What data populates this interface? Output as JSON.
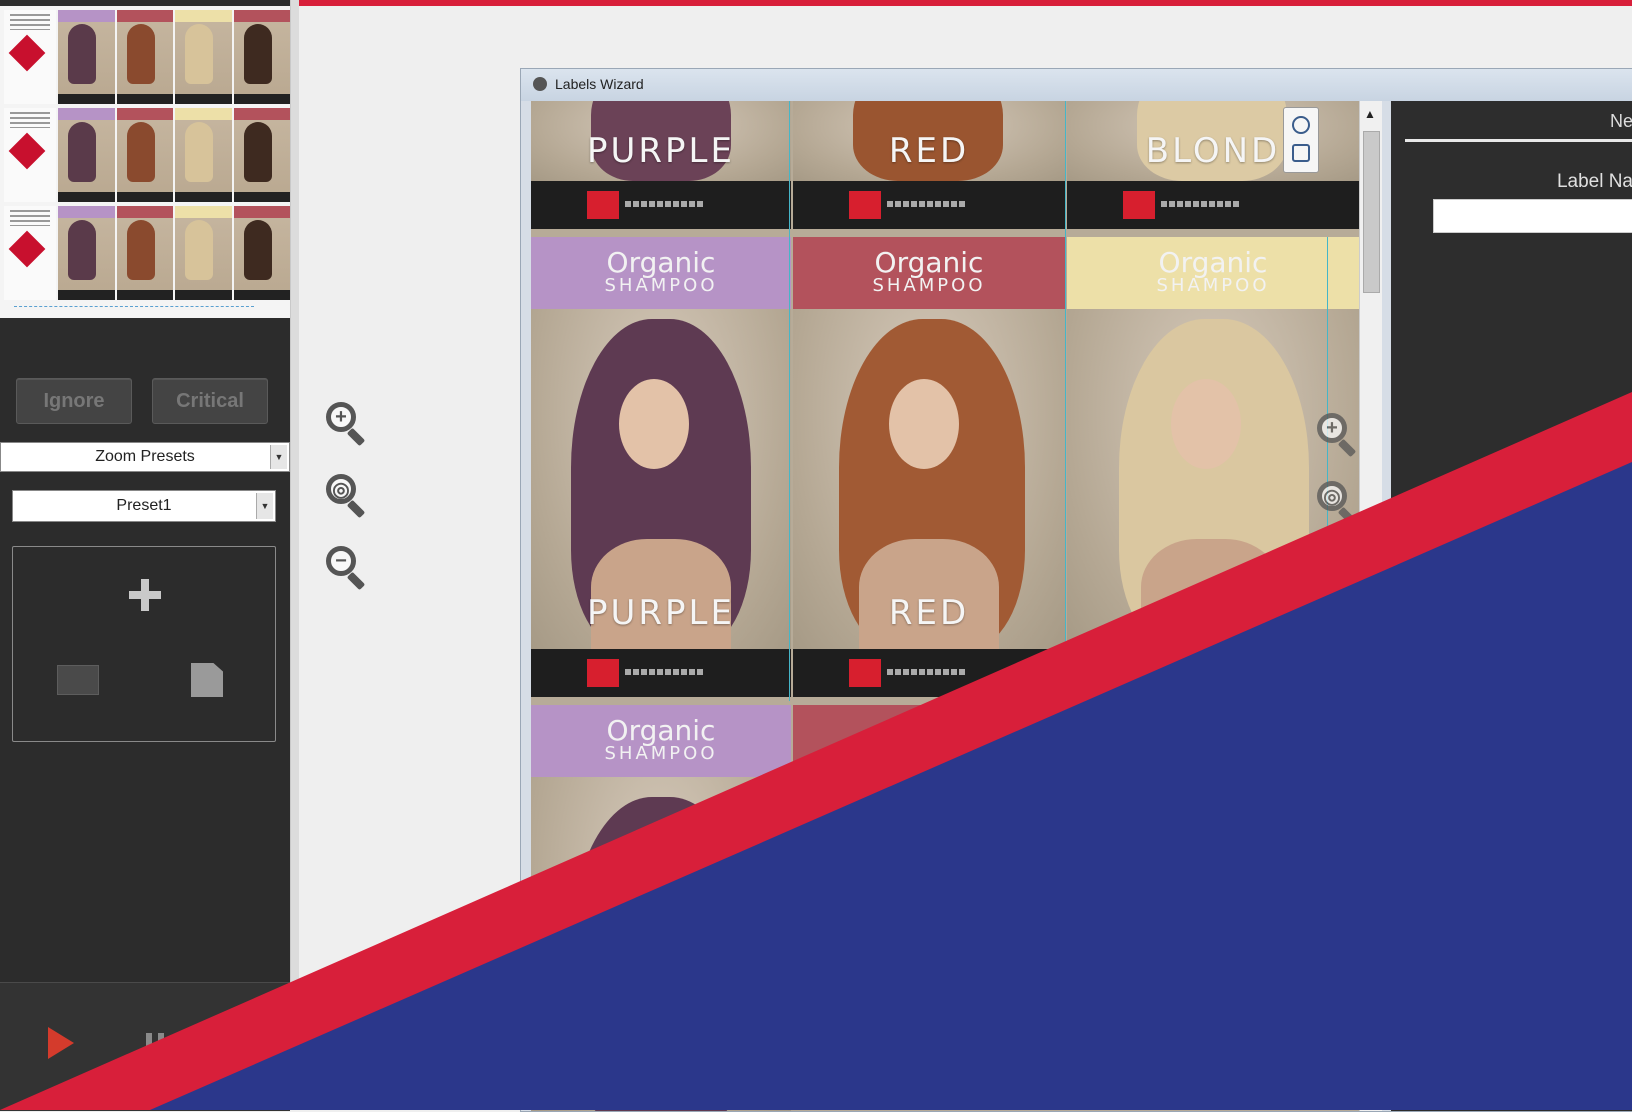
{
  "sidebar": {
    "ignore_label": "Ignore",
    "critical_label": "Critical",
    "zoom_presets_label": "Zoom Presets",
    "preset_value": "Preset1"
  },
  "wizard": {
    "title": "Labels Wizard",
    "right_header": "Ne",
    "label_name_label": "Label Na"
  },
  "labels": {
    "top_row": [
      "PURPLE",
      "RED",
      "BLOND"
    ],
    "organic": "Organic",
    "shampoo": "SHAMPOO",
    "middle_row": [
      "PURPLE",
      "RED"
    ]
  },
  "icons": {
    "zoom_in": "zoom-in-icon",
    "zoom_fit": "zoom-fit-icon",
    "zoom_out": "zoom-out-icon",
    "add": "plus-icon",
    "remove": "remove-icon",
    "save": "save-icon",
    "play": "play-icon",
    "pause": "pause-icon"
  },
  "colors": {
    "accent_red": "#d81f3a",
    "accent_blue": "#2b378b",
    "purple_band": "#b693c6",
    "red_band": "#b3525c",
    "blond_band": "#ede0a8"
  }
}
